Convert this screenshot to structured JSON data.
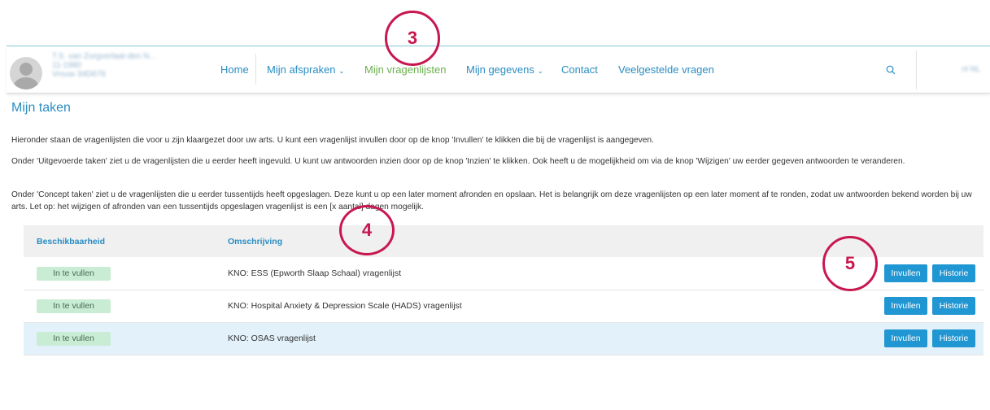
{
  "header": {
    "user": {
      "line1": "T.S. van Zorgverlaat-den N...",
      "line2": "11-1980",
      "line3": "Vrouw 34D678"
    },
    "nav": {
      "home": "Home",
      "afspraken": "Mijn afspraken",
      "vragenlijsten": "Mijn vragenlijsten",
      "gegevens": "Mijn gegevens",
      "contact": "Contact",
      "faq": "Veelgestelde vragen"
    },
    "right_text": "nl NL"
  },
  "page": {
    "title": "Mijn taken",
    "paragraphs": [
      "Hieronder staan de vragenlijsten die voor u zijn klaargezet door uw arts. U kunt een vragenlijst invullen door op de knop 'Invullen' te klikken die bij de vragenlijst is aangegeven.",
      "Onder 'Uitgevoerde taken' ziet u de vragenlijsten die u eerder heeft ingevuld. U kunt uw antwoorden inzien door op de knop 'Inzien' te klikken. Ook heeft u de mogelijkheid om via de knop 'Wijzigen' uw eerder gegeven antwoorden te veranderen.",
      "Onder 'Concept taken' ziet u de vragenlijsten die u eerder tussentijds heeft opgeslagen. Deze kunt u op een later moment afronden en opslaan. Het is belangrijk om deze vragenlijsten op een later moment af te ronden, zodat uw antwoorden bekend worden bij uw arts. Let op: het wijzigen of afronden van een tussentijds opgeslagen vragenlijst is een [x aantal] dagen mogelijk."
    ]
  },
  "table": {
    "columns": [
      "Beschikbaarheid",
      "Omschrijving"
    ],
    "rows": [
      {
        "status": "In te vullen",
        "description": "KNO: ESS (Epworth Slaap Schaal) vragenlijst",
        "fill": "Invullen",
        "history": "Historie"
      },
      {
        "status": "In te vullen",
        "description": "KNO: Hospital Anxiety & Depression Scale (HADS) vragenlijst",
        "fill": "Invullen",
        "history": "Historie"
      },
      {
        "status": "In te vullen",
        "description": "KNO: OSAS vragenlijst",
        "fill": "Invullen",
        "history": "Historie"
      }
    ]
  },
  "annotations": [
    "3",
    "4",
    "5"
  ]
}
